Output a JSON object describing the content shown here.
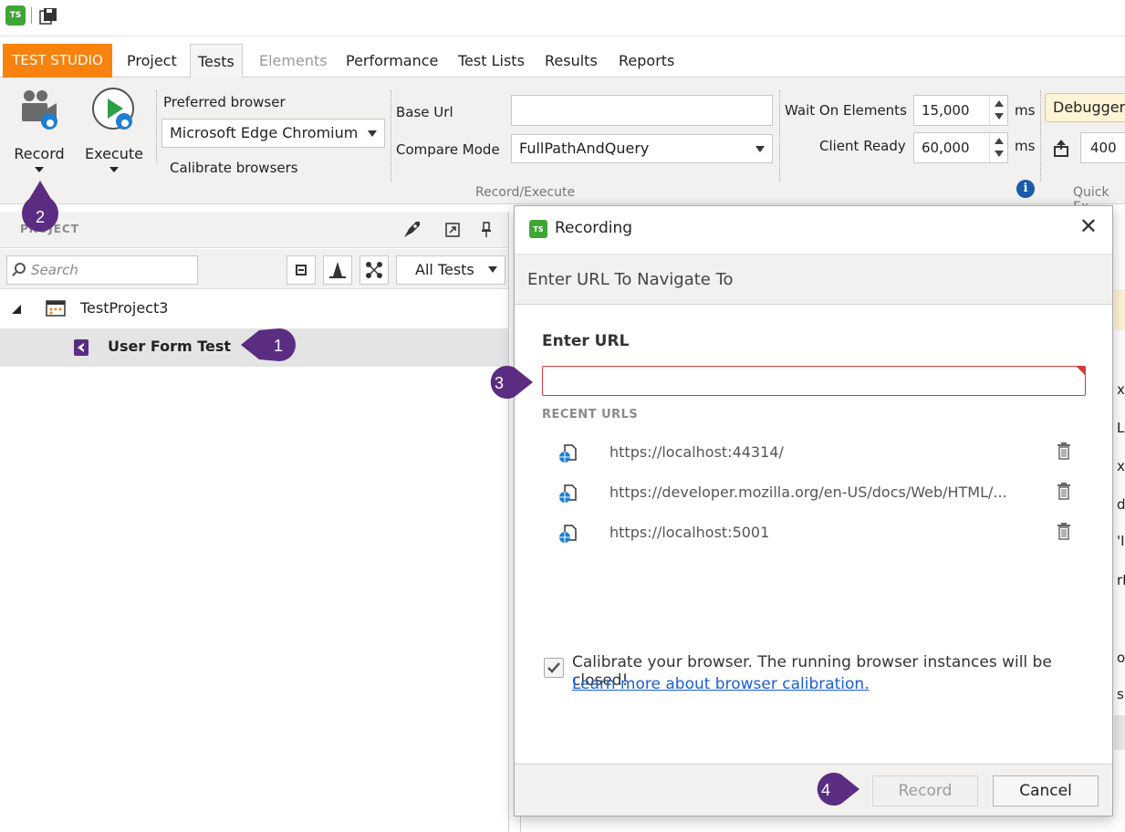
{
  "app": {
    "logo_text": "TS"
  },
  "tabs": [
    {
      "label": "TEST STUDIO"
    },
    {
      "label": "Project"
    },
    {
      "label": "Tests"
    },
    {
      "label": "Elements"
    },
    {
      "label": "Performance"
    },
    {
      "label": "Test Lists"
    },
    {
      "label": "Results"
    },
    {
      "label": "Reports"
    }
  ],
  "ribbon": {
    "record_label": "Record",
    "execute_label": "Execute",
    "preferred_browser_label": "Preferred browser",
    "preferred_browser_value": "Microsoft Edge Chromium",
    "calibrate_label": "Calibrate browsers",
    "base_url_label": "Base Url",
    "base_url_value": "",
    "compare_mode_label": "Compare Mode",
    "compare_mode_value": "FullPathAndQuery",
    "group_label": "Record/Execute",
    "wait_on_elements_label": "Wait On Elements",
    "wait_on_elements_value": "15,000",
    "client_ready_label": "Client Ready",
    "client_ready_value": "60,000",
    "ms_unit": "ms",
    "debugger_label": "Debugger",
    "quick_exec_value": "400",
    "quick_exec_group_label": "Quick Ex"
  },
  "project_panel": {
    "title": "PROJECT",
    "search_placeholder": "Search",
    "filter_value": "All Tests",
    "tree": {
      "project_name": "TestProject3",
      "test_name": "User Form Test"
    }
  },
  "dialog": {
    "title": "Recording",
    "subtitle": "Enter URL To Navigate To",
    "enter_url_label": "Enter URL",
    "url_value": "",
    "recent_label": "RECENT URLS",
    "recent_urls": [
      "https://localhost:44314/",
      "https://developer.mozilla.org/en-US/docs/Web/HTML/...",
      "https://localhost:5001"
    ],
    "calibrate_text": "Calibrate your browser. The running browser instances will be closed!",
    "calibrate_link": "Learn more about browser calibration.",
    "calibrate_checked": true,
    "record_button": "Record",
    "cancel_button": "Cancel"
  },
  "callouts": [
    "1",
    "2",
    "3",
    "4"
  ],
  "right_panel_fragments": [
    "xt",
    "La",
    "xt'",
    "do",
    "'I",
    "rD",
    "ou",
    "sil"
  ],
  "colors": {
    "accent_orange": "#f7830e",
    "callout_purple": "#5b2d82",
    "logo_green": "#3fa535",
    "error_red": "#d23b3b",
    "link_blue": "#1a5fd0"
  }
}
